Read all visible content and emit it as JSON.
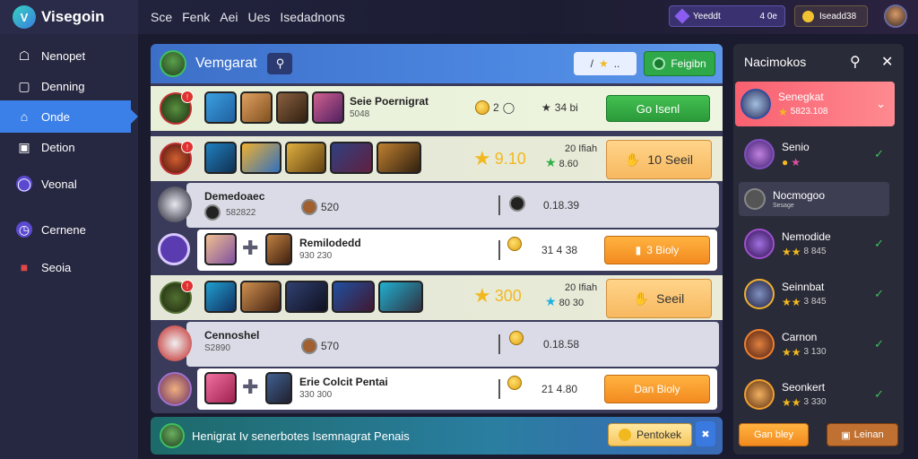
{
  "topbar": {
    "logo_text": "Visegoin",
    "nav": [
      "Sce",
      "Fenk",
      "Aei",
      "Ues",
      "Isedadnons"
    ],
    "gems_label": "Yeeddt",
    "gems_value": "4 0e",
    "gold_value": "Iseadd38"
  },
  "sidebar": {
    "items": [
      {
        "label": "Nenopet",
        "icon": "home-icon"
      },
      {
        "label": "Denning",
        "icon": "square-icon"
      },
      {
        "label": "Onde",
        "icon": "house-icon",
        "active": true
      },
      {
        "label": "Detion",
        "icon": "card-icon"
      },
      {
        "label": "Veonal",
        "icon": "power-icon"
      },
      {
        "label": "Cernene",
        "icon": "clock-icon"
      },
      {
        "label": "Seoia",
        "icon": "flag-icon"
      }
    ]
  },
  "main": {
    "title": "Vemgarat",
    "filter_label": "☆",
    "header_button": "Feigibn",
    "rows": [
      {
        "name": "Seie Poernigrat",
        "sub": "5048",
        "gold": "2",
        "stat": "34 bi",
        "button": "Go Isenl"
      },
      {
        "gold": "9.10",
        "stat_a": "20 Ifiah",
        "stat_b": "8.60",
        "button": "10 Seeil"
      },
      {
        "name": "Demedoaec",
        "sub": "582822",
        "s1": "520",
        "s2": "0.18.39"
      },
      {
        "name": "Remilodedd",
        "sub": "930 230",
        "s2": "31 4 38",
        "button": "3 Bioly"
      },
      {
        "gold": "300",
        "stat_a": "20 Ifiah",
        "stat_b": "80 30",
        "button": "Seeil"
      },
      {
        "name": "Cennoshel",
        "sub": "S2890",
        "s1": "570",
        "s2": "0.18.58"
      },
      {
        "name": "Erie Colcit Pentai",
        "sub": "330 300",
        "s2": "21 4.80",
        "button": "Dan Bioly"
      }
    ]
  },
  "footer": {
    "text": "Henigrat Iv senerbotes Isemnagrat Penais",
    "button": "Pentokek"
  },
  "right": {
    "title": "Nacimokos",
    "items": [
      {
        "name": "Senegkat",
        "sub": "5823.108"
      },
      {
        "name": "Senio",
        "sub": ""
      },
      {
        "name": "Nocmogoo",
        "sub": "Sesage"
      },
      {
        "name": "Nemodide",
        "sub": "8 845"
      },
      {
        "name": "Seinnbat",
        "sub": "3 845"
      },
      {
        "name": "Carnon",
        "sub": "3 130"
      },
      {
        "name": "Seonkert",
        "sub": "3 330"
      }
    ],
    "btn_left": "Gan bley",
    "btn_right": "Leinan"
  },
  "colors": {
    "accent_blue": "#3b80e8",
    "action_green": "#2fa84a",
    "action_orange": "#f28a20",
    "highlight_pink": "#f86070"
  }
}
